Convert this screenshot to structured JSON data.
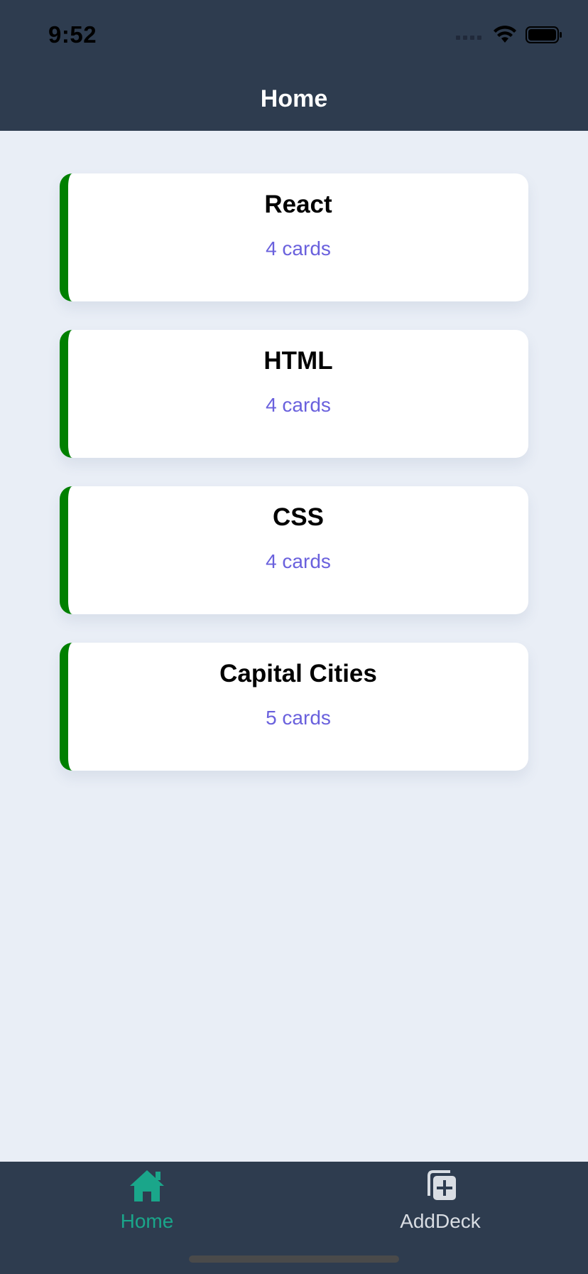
{
  "status_bar": {
    "time": "9:52"
  },
  "header": {
    "title": "Home"
  },
  "decks": [
    {
      "title": "React",
      "count": "4 cards"
    },
    {
      "title": "HTML",
      "count": "4 cards"
    },
    {
      "title": "CSS",
      "count": "4 cards"
    },
    {
      "title": "Capital Cities",
      "count": "5 cards"
    }
  ],
  "tabs": [
    {
      "label": "Home",
      "icon": "home-icon",
      "active": true,
      "color": "#1aa68a"
    },
    {
      "label": "AddDeck",
      "icon": "add-deck-icon",
      "active": false,
      "color": "#d9dde3"
    }
  ],
  "colors": {
    "header_bg": "#2e3c4f",
    "page_bg": "#e9eef6",
    "card_accent": "#008000",
    "count_text": "#6a61dd"
  }
}
